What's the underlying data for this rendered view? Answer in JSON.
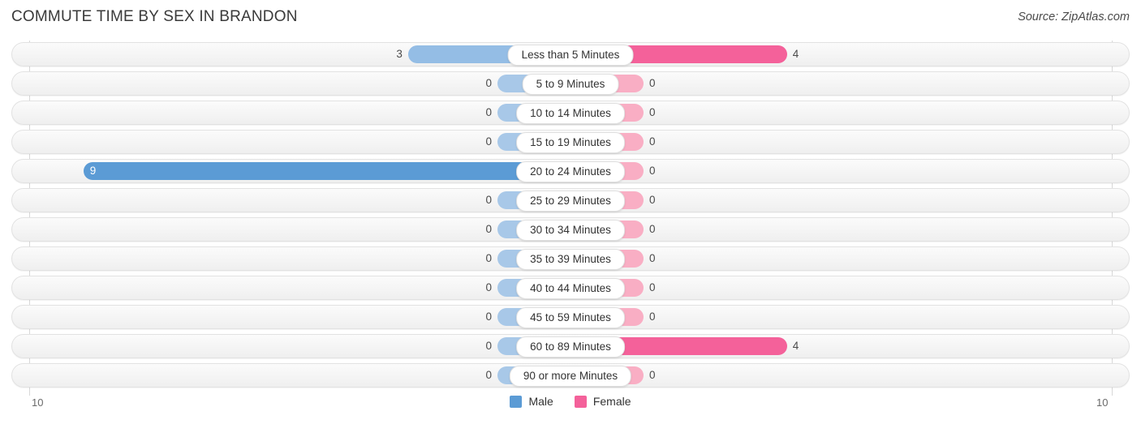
{
  "header": {
    "title": "COMMUTE TIME BY SEX IN BRANDON",
    "source": "Source: ZipAtlas.com"
  },
  "axis": {
    "left_label": "10",
    "right_label": "10"
  },
  "legend": {
    "items": [
      {
        "label": "Male",
        "color": "#5B9BD5"
      },
      {
        "label": "Female",
        "color": "#F4619A"
      }
    ]
  },
  "colors": {
    "male_strong": "#5B9BD5",
    "male_light": "#94BDE5",
    "male_zero": "#A8C8E8",
    "female_strong": "#F4619A",
    "female_light": "#F77DA6",
    "female_zero": "#F9AEC4",
    "track": "#F4F4F4",
    "text": "#4a4a4a"
  },
  "chart_data": {
    "type": "bar",
    "title": "COMMUTE TIME BY SEX IN BRANDON",
    "subtitle": "Source: ZipAtlas.com",
    "orientation": "horizontal-diverging",
    "xlabel": "",
    "ylabel": "",
    "xlim": [
      10,
      10
    ],
    "axis_left_max": 10,
    "axis_right_max": 10,
    "grid": false,
    "legend_position": "bottom-center",
    "categories": [
      "Less than 5 Minutes",
      "5 to 9 Minutes",
      "10 to 14 Minutes",
      "15 to 19 Minutes",
      "20 to 24 Minutes",
      "25 to 29 Minutes",
      "30 to 34 Minutes",
      "35 to 39 Minutes",
      "40 to 44 Minutes",
      "45 to 59 Minutes",
      "60 to 89 Minutes",
      "90 or more Minutes"
    ],
    "series": [
      {
        "name": "Male",
        "values": [
          3,
          0,
          0,
          0,
          9,
          0,
          0,
          0,
          0,
          0,
          0,
          0
        ]
      },
      {
        "name": "Female",
        "values": [
          4,
          0,
          0,
          0,
          0,
          0,
          0,
          0,
          0,
          0,
          4,
          0
        ]
      }
    ]
  },
  "rows": [
    {
      "category": "Less than 5 Minutes",
      "male": "3",
      "female": "4"
    },
    {
      "category": "5 to 9 Minutes",
      "male": "0",
      "female": "0"
    },
    {
      "category": "10 to 14 Minutes",
      "male": "0",
      "female": "0"
    },
    {
      "category": "15 to 19 Minutes",
      "male": "0",
      "female": "0"
    },
    {
      "category": "20 to 24 Minutes",
      "male": "9",
      "female": "0"
    },
    {
      "category": "25 to 29 Minutes",
      "male": "0",
      "female": "0"
    },
    {
      "category": "30 to 34 Minutes",
      "male": "0",
      "female": "0"
    },
    {
      "category": "35 to 39 Minutes",
      "male": "0",
      "female": "0"
    },
    {
      "category": "40 to 44 Minutes",
      "male": "0",
      "female": "0"
    },
    {
      "category": "45 to 59 Minutes",
      "male": "0",
      "female": "0"
    },
    {
      "category": "60 to 89 Minutes",
      "male": "0",
      "female": "4"
    },
    {
      "category": "90 or more Minutes",
      "male": "0",
      "female": "0"
    }
  ]
}
